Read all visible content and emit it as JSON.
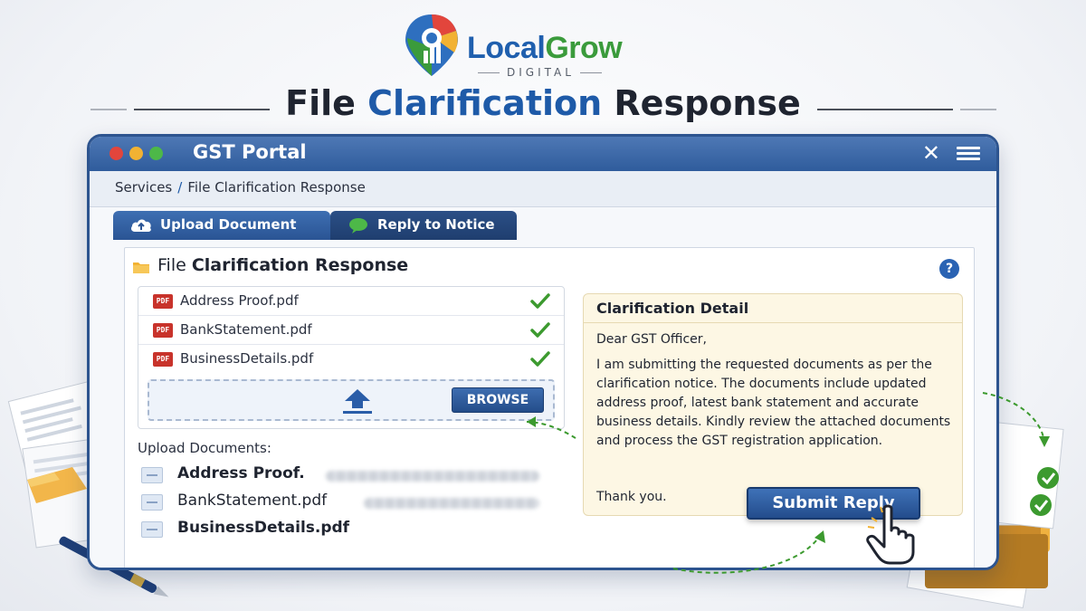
{
  "brand": {
    "name_part1": "Local",
    "name_part2": "Grow",
    "subtitle": "DIGITAL"
  },
  "heading": {
    "part1": "File ",
    "part2": "Clarification",
    "part3": " Response"
  },
  "window": {
    "title": "GST Portal",
    "close_glyph": "✕"
  },
  "breadcrumb": {
    "root": "Services",
    "separator": "/",
    "current": "File Clarification Response"
  },
  "tabs": [
    {
      "label": "Upload Document",
      "icon": "cloud-upload-icon",
      "active": true
    },
    {
      "label": "Reply to Notice",
      "icon": "chat-bubble-icon",
      "active": false
    }
  ],
  "panel": {
    "title_part1": "File ",
    "title_part2": "Clarification Response",
    "help_glyph": "?"
  },
  "attached_files": [
    {
      "name": "Address Proof.pdf",
      "badge": "PDF",
      "status": "verified"
    },
    {
      "name": "BankStatement.pdf",
      "badge": "PDF",
      "status": "verified"
    },
    {
      "name": "BusinessDetails.pdf",
      "badge": "PDF",
      "status": "verified"
    }
  ],
  "dropzone": {
    "browse_label": "BROWSE"
  },
  "uploads": {
    "label": "Upload Documents:",
    "items": [
      {
        "name": "Address Proof."
      },
      {
        "name": "BankStatement.pdf"
      },
      {
        "name": "BusinessDetails.pdf"
      }
    ]
  },
  "detail": {
    "title": "Clarification Detail",
    "greeting": "Dear GST Officer,",
    "body": "I am submitting the requested documents as per the clarification notice. The documents include updated address proof, latest bank statement and accurate business details. Kindly review the attached documents and process the GST registration application.",
    "closing": "Thank you."
  },
  "submit": {
    "label": "Submit Reply"
  },
  "colors": {
    "primary": "#2d548f",
    "accent_blue": "#1e5aa8",
    "brand_green": "#3b9b3c",
    "check_green": "#3c9a2f",
    "pdf_red": "#c8332b",
    "note_bg": "#fdf7e4"
  }
}
